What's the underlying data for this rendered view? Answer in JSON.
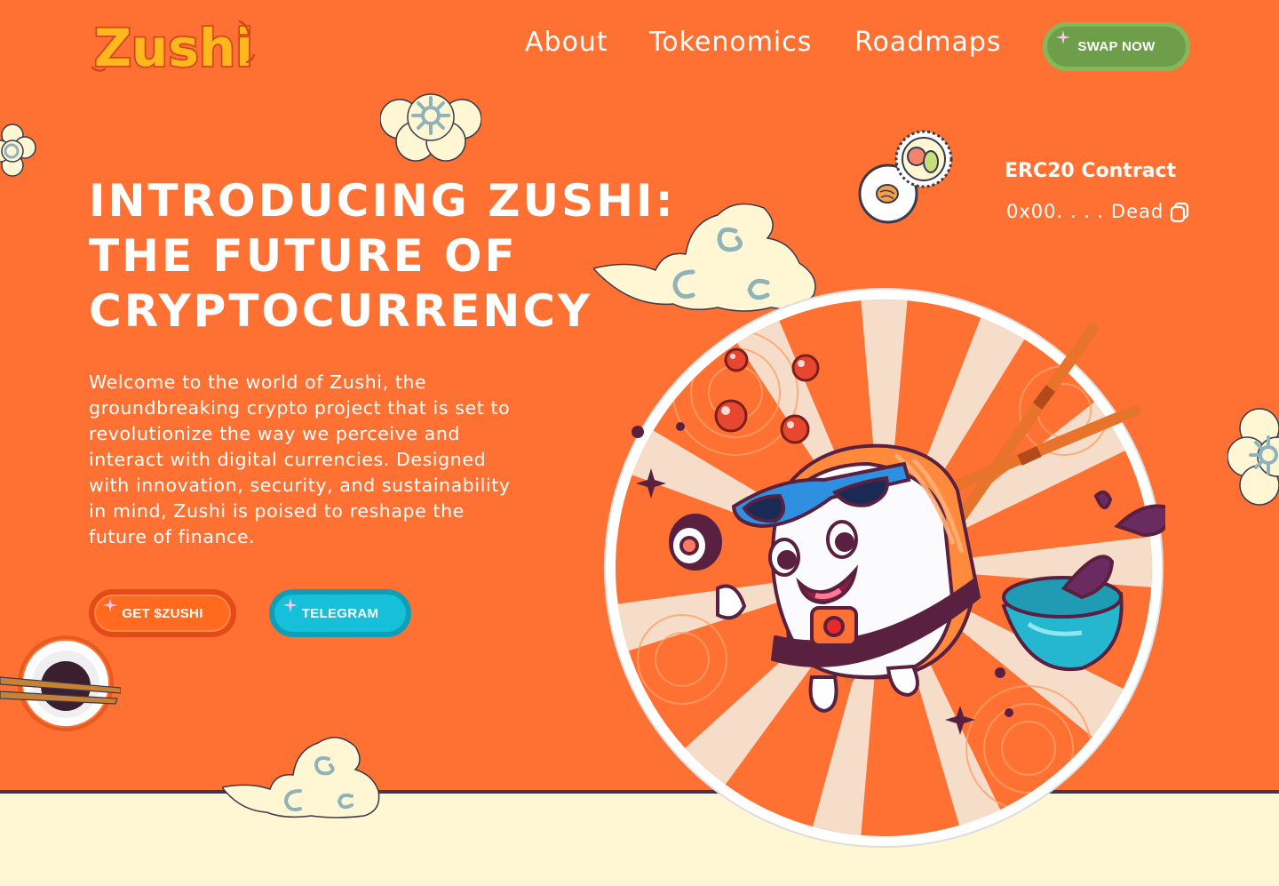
{
  "header": {
    "logo_text": "Zushi",
    "nav": [
      {
        "label": "About"
      },
      {
        "label": "Tokenomics"
      },
      {
        "label": "Roadmaps"
      }
    ],
    "swap_button": "SWAP NOW"
  },
  "hero": {
    "title_lines": [
      "INTRODUCING ZUSHI:",
      "THE FUTURE OF",
      "CRYPTOCURRENCY"
    ],
    "description": "Welcome to the world of Zushi, the groundbreaking crypto project that is set to revolutionize the way we perceive and interact with digital currencies. Designed with innovation, security, and sustainability in mind, Zushi is poised to reshape the future of finance.",
    "buttons": {
      "get": "GET $ZUSHI",
      "telegram": "TELEGRAM"
    }
  },
  "contract": {
    "title": "ERC20 Contract",
    "address": "0x00. . . . Dead"
  },
  "colors": {
    "background": "#ff7133",
    "band": "#fff6d3",
    "swap": "#6e9e4a",
    "get": "#ff6a1e",
    "telegram": "#17c0da"
  },
  "icons": [
    "copy-icon",
    "sparkle-icon",
    "cloud-icon",
    "flower-icon",
    "sushi-icon",
    "soy-sauce-icon",
    "sushi-mascot-illustration"
  ]
}
